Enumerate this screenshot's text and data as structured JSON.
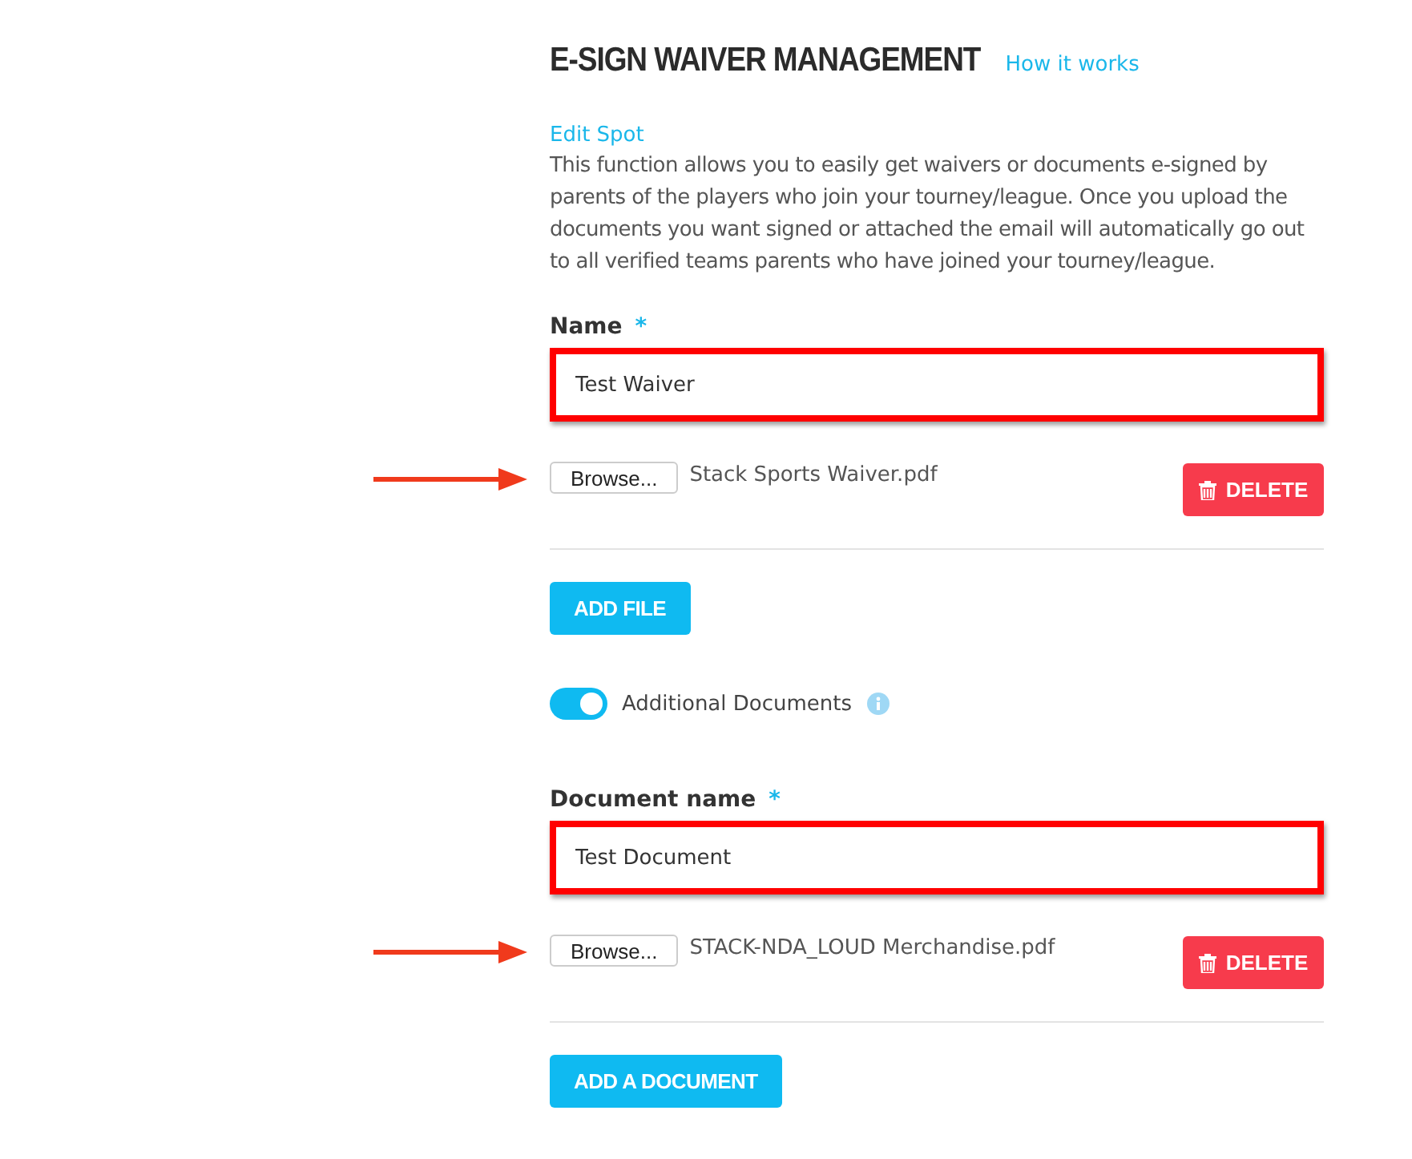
{
  "header": {
    "title": "E-SIGN WAIVER MANAGEMENT",
    "help_link": "How it works"
  },
  "edit_link": "Edit Spot",
  "description": "This function allows you to easily get waivers or documents e-signed by parents of the players who join your tourney/league. Once you upload the documents you want signed or attached the email will automatically go out to all verified teams parents who have joined your tourney/league.",
  "name_field": {
    "label": "Name",
    "required_mark": "*",
    "value": "Test Waiver"
  },
  "files": [
    {
      "browse": "Browse...",
      "file_name": "Stack Sports Waiver.pdf",
      "delete": "DELETE"
    }
  ],
  "add_file": "ADD FILE",
  "additional_documents": {
    "label": "Additional Documents",
    "on": true
  },
  "document_field": {
    "label": "Document name",
    "required_mark": "*",
    "value": "Test Document"
  },
  "document_files": [
    {
      "browse": "Browse...",
      "file_name": "STACK-NDA_LOUD Merchandise.pdf",
      "delete": "DELETE"
    }
  ],
  "add_document": "ADD A DOCUMENT"
}
